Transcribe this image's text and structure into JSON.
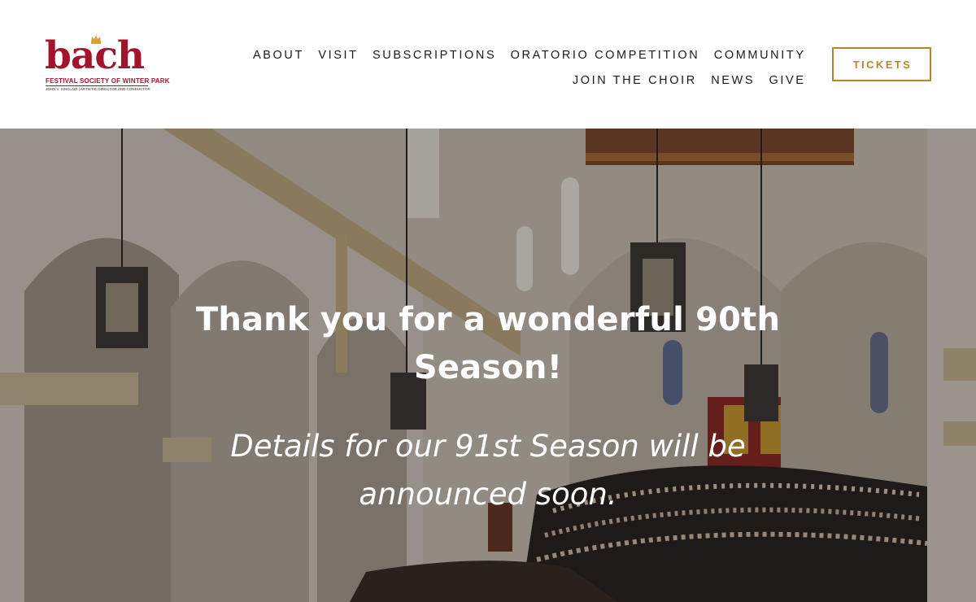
{
  "brand": {
    "wordmark": "bach",
    "subtitle": "FESTIVAL SOCIETY OF WINTER PARK",
    "credit": "JOHN V. SINCLAIR | ARTISTIC DIRECTOR AND CONDUCTOR",
    "primary_color": "#a3132d",
    "crown_color": "#d4a534"
  },
  "nav": {
    "row1": [
      "ABOUT",
      "VISIT",
      "SUBSCRIPTIONS",
      "ORATORIO COMPETITION",
      "COMMUNITY"
    ],
    "row2": [
      "JOIN THE CHOIR",
      "NEWS",
      "GIVE"
    ],
    "tickets_label": "TICKETS",
    "accent_color": "#b8862b"
  },
  "hero": {
    "title": "Thank you for a wonderful 90th Season!",
    "subtitle": "Details for our 91st Season will be announced soon."
  }
}
